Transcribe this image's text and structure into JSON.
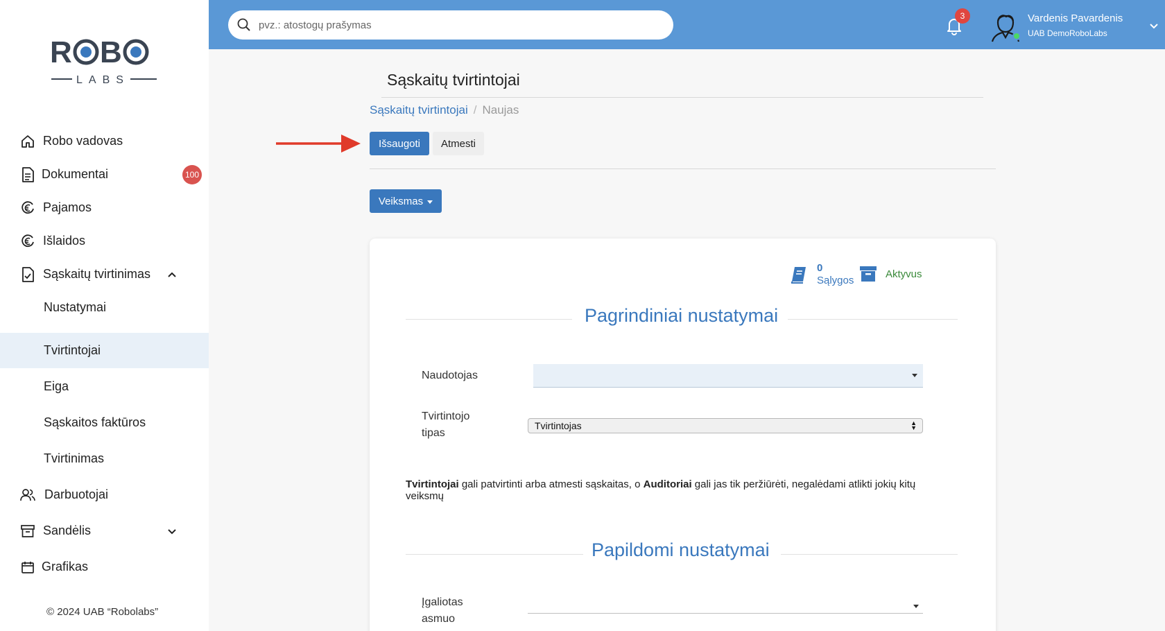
{
  "brand": {
    "logo_top": "ROBO",
    "logo_bottom": "LABS"
  },
  "sidebar": {
    "items": [
      {
        "label": "Robo vadovas",
        "icon": "home-icon"
      },
      {
        "label": "Dokumentai",
        "icon": "document-icon",
        "badge": "100"
      },
      {
        "label": "Pajamos",
        "icon": "euro-circle-icon"
      },
      {
        "label": "Išlaidos",
        "icon": "euro-circle-icon"
      },
      {
        "label": "Sąskaitų tvirtinimas",
        "icon": "file-check-icon",
        "expanded": true
      },
      {
        "label": "Nustatymai",
        "sub": true
      },
      {
        "label": "Tvirtintojai",
        "sub": true,
        "active": true
      },
      {
        "label": "Eiga",
        "sub": true
      },
      {
        "label": "Sąskaitos faktūros",
        "sub": true
      },
      {
        "label": "Tvirtinimas",
        "sub": true
      },
      {
        "label": "Darbuotojai",
        "icon": "users-icon"
      },
      {
        "label": "Sandėlis",
        "icon": "archive-icon",
        "expanded": false
      },
      {
        "label": "Grafikas",
        "icon": "calendar-icon"
      }
    ],
    "copyright": "© 2024 UAB “Robolabs”"
  },
  "topbar": {
    "search_placeholder": "pvz.: atostogų prašymas",
    "notifications_count": "3",
    "user_name": "Vardenis Pavardenis",
    "user_company": "UAB DemoRoboLabs"
  },
  "page": {
    "title": "Sąskaitų tvirtintojai",
    "breadcrumb": {
      "parent": "Sąskaitų tvirtintojai",
      "separator": "/",
      "current": "Naujas"
    },
    "save_label": "Išsaugoti",
    "discard_label": "Atmesti",
    "action_label": "Veiksmas"
  },
  "form": {
    "stats": {
      "conditions_count": "0",
      "conditions_label": "Sąlygos",
      "status_label": "Aktyvus"
    },
    "section_main": "Pagrindiniai nustatymai",
    "user_label": "Naudotojas",
    "user_value": "",
    "type_label_line1": "Tvirtintojo",
    "type_label_line2": "tipas",
    "type_value": "Tvirtintojas",
    "info": {
      "part1": "Tvirtintojai",
      "part2": " gali patvirtinti arba atmesti sąskaitas, o ",
      "part3": "Auditoriai",
      "part4": " gali jas tik peržiūrėti, negalėdami atlikti jokių kitų veiksmų"
    },
    "section_extra": "Papildomi nustatymai",
    "delegate_label_line1": "Įgaliotas",
    "delegate_label_line2": "asmuo"
  },
  "colors": {
    "accent": "#3a78bd",
    "topbar": "#5a98d6",
    "badge": "#d9534f",
    "active_bg": "#e8f0f8",
    "status_green": "#3a8a3a"
  }
}
